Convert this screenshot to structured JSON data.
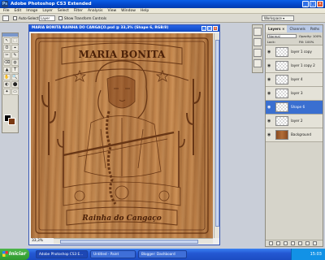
{
  "app": {
    "title": "Adobe Photoshop CS3 Extended",
    "badge": "Ps"
  },
  "window_buttons": {
    "minimize": "_",
    "maximize": "□",
    "close": "×"
  },
  "menu": [
    "File",
    "Edit",
    "Image",
    "Layer",
    "Select",
    "Filter",
    "Analysis",
    "View",
    "Window",
    "Help"
  ],
  "options_bar": {
    "auto_select_label": "Auto-Select:",
    "auto_select_value": "Layer",
    "show_transform_label": "Show Transform Controls",
    "workspace": "Workspace ▾"
  },
  "tools": [
    "↖",
    "⬚",
    "ʘ",
    "⌖",
    "✂",
    "✎",
    "⌫",
    "◍",
    "▲",
    "T",
    "✋",
    "🔍",
    "◐",
    "⬤",
    "✦",
    "▭"
  ],
  "colors": {
    "foreground": "#000000",
    "background": "#7a3a12",
    "accent": "#0a5fe8"
  },
  "document": {
    "title": "MARIA BONITA RAINHA DO CANGAÇO.psd @ 33,3% (Shape 6, RGB/8)",
    "zoom": "33,3%",
    "artwork_title": "MARIA BONITA",
    "artwork_subtitle": "Rainha do Cangaço"
  },
  "layers_panel": {
    "tabs": [
      "Layers ×",
      "Channels",
      "Paths"
    ],
    "blend_mode": "Normal",
    "opacity_label": "Opacity: 100%",
    "lock_label": "Lock:",
    "fill_label": "Fill: 100%",
    "layers": [
      {
        "name": "layer 1 copy",
        "active": false
      },
      {
        "name": "layer 1 copy 2",
        "active": false
      },
      {
        "name": "layer 4",
        "active": false
      },
      {
        "name": "layer 3",
        "active": false
      },
      {
        "name": "Shape 6",
        "active": true
      },
      {
        "name": "layer 2",
        "active": false
      },
      {
        "name": "Background",
        "active": false
      }
    ]
  },
  "taskbar": {
    "start_label": "Iniciar",
    "tasks": [
      "Adobe Photoshop CS3 E...",
      "Untitled - Paint",
      "Blogger: Dashboard"
    ],
    "clock": "15:03"
  }
}
